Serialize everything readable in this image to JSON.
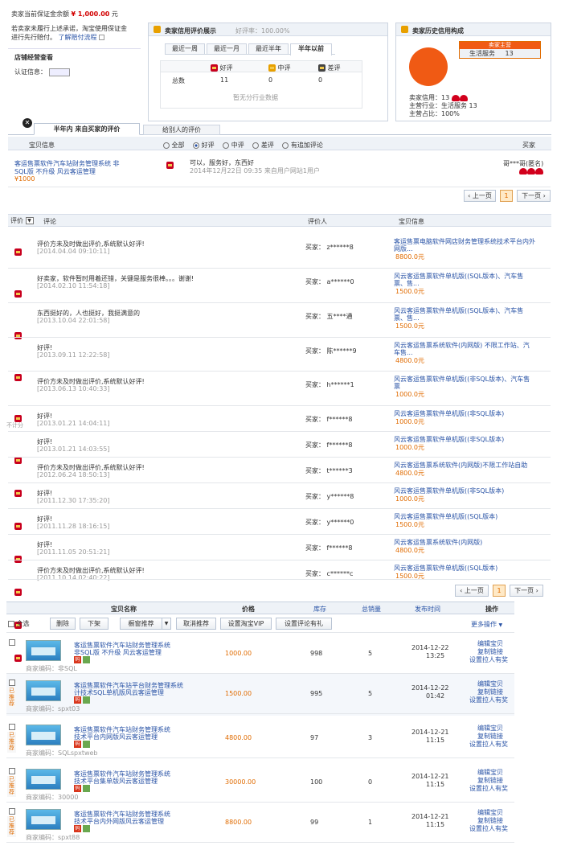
{
  "top": {
    "deposit_label": "卖家当前保证金余额",
    "deposit_value": "¥ 1,000.00",
    "deposit_unit": "元",
    "promise_line1": "若卖家未履行上述承诺，淘宝使用保证金",
    "promise_line2": "进行先行赔付。",
    "promise_link": "了解赔付流程",
    "shop_section": "店铺经营查看",
    "cert_label": "认证信息："
  },
  "rating_box": {
    "title": "卖家信用评价展示",
    "good_rate": "好评率：100.00%",
    "tabs": [
      "最近一周",
      "最近一月",
      "最近半年",
      "半年以前"
    ],
    "cols": [
      "好评",
      "中评",
      "差评"
    ],
    "row_label": "总数",
    "values": [
      "11",
      "0",
      "0"
    ],
    "no_data": "暂无分行业数据"
  },
  "history_box": {
    "title": "卖家历史信用构成",
    "tooltip_title": "卖家主营",
    "tooltip_item": "生活服务",
    "tooltip_value": "13",
    "credit_line": "卖家信用：13",
    "industry_line": "主营行业：生活服务  13",
    "ratio_line": "主营占比：100%",
    "pie_color": "#f05a14"
  },
  "review_tabs": {
    "tabs": [
      "半年内 来自买家的评价",
      "给别人的评价"
    ],
    "item_info": "宝贝信息",
    "filters": [
      "全部",
      "好评",
      "中评",
      "差评",
      "有追加评论"
    ],
    "buyer": "买家"
  },
  "recent_review": {
    "item_name_1": "客运售票软件汽车站财务管理系统 非",
    "item_name_2": "SQL版 不升级 风云客运管理",
    "price": "¥1000",
    "comment": "可以，服务好，东西好",
    "meta": "2014年12月22日 09:35 来自用户网站1用户",
    "buyer": "哥***哥(匿名)"
  },
  "pager1": {
    "prev": "‹ 上一页",
    "current": "1",
    "next": "下一页 ›"
  },
  "comments": {
    "header": {
      "rate": "评价",
      "comment": "评论",
      "buyer": "评价人",
      "item": "宝贝信息"
    },
    "rows": [
      {
        "tag": "",
        "text": "评价方未及时做出评价,系统默认好评!",
        "date": "[2014.04.04 09:10:11]",
        "buyer": "买家： z******8",
        "item1": "客运售票电脑软件网店财务管理系统技术平台内外",
        "item2": "网版...",
        "price": "8800.0元"
      },
      {
        "tag": "",
        "text": "好卖家，软件暂时用着还错，关键是服务很棒。。。谢谢!",
        "date": "[2014.02.10 11:54:18]",
        "buyer": "买家： a******0",
        "item1": "风云客运售票软件单机版((SQL版本)、汽车售",
        "item2": "票、售...",
        "price": "1500.0元"
      },
      {
        "tag": "",
        "text": "东西挺好的，人也挺好，我挺满意的",
        "date": "[2013.10.04 22:01:58]",
        "buyer": "买家： 五****通",
        "item1": "风云客运售票软件单机版((SQL版本)、汽车售",
        "item2": "票、售...",
        "price": "1500.0元"
      },
      {
        "tag": "",
        "text": "好评!",
        "date": "[2013.09.11 12:22:58]",
        "buyer": "买家： 陈******9",
        "item1": "风云客运售票系统软件(内网版)  不限工作站、汽",
        "item2": "车售...",
        "price": "4800.0元"
      },
      {
        "tag": "",
        "text": "评价方未及时做出评价,系统默认好评!",
        "date": "[2013.06.13 10:40:33]",
        "buyer": "买家： h******1",
        "item1": "风云客运售票软件单机版((非SQL版本)、汽车售",
        "item2": "票",
        "price": "1000.0元"
      },
      {
        "tag": "不计分",
        "text": "好评!",
        "date": "[2013.01.21 14:04:11]",
        "buyer": "买家： f******8",
        "item1": "风云客运售票软件单机版((非SQL版本)",
        "item2": "",
        "price": "1000.0元"
      },
      {
        "tag": "",
        "text": "好评!",
        "date": "[2013.01.21 14:03:55]",
        "buyer": "买家： f******8",
        "item1": "风云客运售票软件单机版((非SQL版本)",
        "item2": "",
        "price": "1000.0元"
      },
      {
        "tag": "",
        "text": "评价方未及时做出评价,系统默认好评!",
        "date": "[2012.06.24 18:50:13]",
        "buyer": "买家： t******3",
        "item1": "风云客运售票系统软件(内网版)不限工作站自助",
        "item2": "",
        "price": "4800.0元"
      },
      {
        "tag": "",
        "text": "好评!",
        "date": "[2011.12.30 17:35:20]",
        "buyer": "买家： y******8",
        "item1": "风云客运售票软件单机版((非SQL版本)",
        "item2": "",
        "price": "1000.0元"
      },
      {
        "tag": "",
        "text": "好评!",
        "date": "[2011.11.28 18:16:15]",
        "buyer": "买家： y******0",
        "item1": "风云客运售票软件单机版((SQL版本)",
        "item2": "",
        "price": "1500.0元"
      },
      {
        "tag": "",
        "text": "好评!",
        "date": "[2011.11.05 20:51:21]",
        "buyer": "买家： f******8",
        "item1": "风云客运售票系统软件(内网版)",
        "item2": "",
        "price": "4800.0元"
      },
      {
        "tag": "",
        "text": "评价方未及时做出评价,系统默认好评!",
        "date": "[2011.10.14 02:40:22]",
        "buyer": "买家： c******c",
        "item1": "风云客运售票软件单机版((SQL版本)",
        "item2": "",
        "price": "1500.0元"
      }
    ]
  },
  "pager2": {
    "prev": "‹ 上一页",
    "current": "1",
    "next": "下一页 ›"
  },
  "goods": {
    "header": {
      "name": "宝贝名称",
      "price": "价格",
      "stock": "库存",
      "sales": "总销量",
      "time": "发布时间",
      "ops": "操作"
    },
    "select_all": "全选",
    "toolbar": [
      "删除",
      "下架",
      "橱窗推荐",
      "取消推荐",
      "设置淘宝VIP",
      "设置评论有礼"
    ],
    "more_ops": "更多操作",
    "op_links": [
      "编辑宝贝",
      "复制链接",
      "设置拉人有奖"
    ],
    "code_label": "商家编码：",
    "recommended_tag": "已推荐",
    "rows": [
      {
        "recommended": false,
        "name1": "客运售票软件汽车站财务管理系统",
        "name2": "非SQL版 不升级 风云客运管理",
        "code": "非SQL",
        "price": "1000.00",
        "stock": "998",
        "sales": "5",
        "date": "2014-12-22",
        "time": "13:25"
      },
      {
        "recommended": true,
        "name1": "客运售票软件汽车站平台财务管理系统",
        "name2": "计技术SQL单机版风云客运管理",
        "code": "spxt03",
        "price": "1500.00",
        "stock": "995",
        "sales": "5",
        "date": "2014-12-22",
        "time": "01:42"
      },
      {
        "recommended": true,
        "name1": "客运售票软件汽车站财务管理系统",
        "name2": "技术平台内网版风云客运管理",
        "code": "SQLspxtweb",
        "price": "4800.00",
        "stock": "97",
        "sales": "3",
        "date": "2014-12-21",
        "time": "11:15"
      },
      {
        "recommended": true,
        "name1": "客运售票软件汽车站财务管理系统",
        "name2": "技术平台集单版风云客运管理",
        "code": "30000",
        "price": "30000.00",
        "stock": "100",
        "sales": "0",
        "date": "2014-12-21",
        "time": "11:15"
      },
      {
        "recommended": true,
        "name1": "客运售票软件汽车站财务管理系统",
        "name2": "技术平台内外网版风云客运管理",
        "code": "spxt88",
        "price": "8800.00",
        "stock": "99",
        "sales": "1",
        "date": "2014-12-21",
        "time": "11:15"
      }
    ]
  }
}
